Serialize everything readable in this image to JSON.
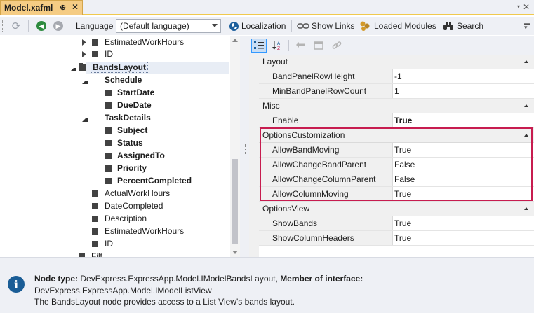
{
  "window": {
    "tab_title": "Model.xafml",
    "pin_glyph": "⊕",
    "close_glyph": "✕",
    "menu_glyph": "▾",
    "window_close_glyph": "✕"
  },
  "toolbar": {
    "language_label": "Language",
    "language_value": "(Default language)",
    "localization_label": "Localization",
    "show_links_label": "Show Links",
    "loaded_modules_label": "Loaded Modules",
    "search_label": "Search"
  },
  "tree": {
    "items": [
      {
        "label": "EstimatedWorkHours",
        "bold": false
      },
      {
        "label": "ID",
        "bold": false
      },
      {
        "label": "BandsLayout",
        "bold": true
      },
      {
        "label": "Schedule",
        "bold": true
      },
      {
        "label": "StartDate",
        "bold": true
      },
      {
        "label": "DueDate",
        "bold": true
      },
      {
        "label": "TaskDetails",
        "bold": true
      },
      {
        "label": "Subject",
        "bold": true
      },
      {
        "label": "Status",
        "bold": true
      },
      {
        "label": "AssignedTo",
        "bold": true
      },
      {
        "label": "Priority",
        "bold": true
      },
      {
        "label": "PercentCompleted",
        "bold": true
      },
      {
        "label": "ActualWorkHours",
        "bold": false
      },
      {
        "label": "DateCompleted",
        "bold": false
      },
      {
        "label": "Description",
        "bold": false
      },
      {
        "label": "EstimatedWorkHours",
        "bold": false
      },
      {
        "label": "ID",
        "bold": false
      },
      {
        "label": "Filt",
        "bold": false
      }
    ]
  },
  "property_grid": {
    "categories": [
      {
        "name": "Layout",
        "properties": [
          {
            "name": "BandPanelRowHeight",
            "value": "-1",
            "bold": false
          },
          {
            "name": "MinBandPanelRowCount",
            "value": "1",
            "bold": false
          }
        ]
      },
      {
        "name": "Misc",
        "properties": [
          {
            "name": "Enable",
            "value": "True",
            "bold": true
          }
        ]
      },
      {
        "name": "OptionsCustomization",
        "highlighted": true,
        "properties": [
          {
            "name": "AllowBandMoving",
            "value": "True",
            "bold": false
          },
          {
            "name": "AllowChangeBandParent",
            "value": "False",
            "bold": false
          },
          {
            "name": "AllowChangeColumnParent",
            "value": "False",
            "bold": false
          },
          {
            "name": "AllowColumnMoving",
            "value": "True",
            "bold": false
          }
        ]
      },
      {
        "name": "OptionsView",
        "properties": [
          {
            "name": "ShowBands",
            "value": "True",
            "bold": false
          },
          {
            "name": "ShowColumnHeaders",
            "value": "True",
            "bold": false
          }
        ]
      }
    ]
  },
  "info": {
    "node_type_label": "Node type:",
    "node_type_value": "DevExpress.ExpressApp.Model.IModelBandsLayout,",
    "member_label": "Member of interface:",
    "member_value": "DevExpress.ExpressApp.Model.IModelListView",
    "description": "The BandsLayout node provides access to a List View's bands layout."
  },
  "colors": {
    "tab_active": "#f5cc84",
    "highlight_border": "#c71c4f",
    "info_icon": "#1a5d96"
  }
}
